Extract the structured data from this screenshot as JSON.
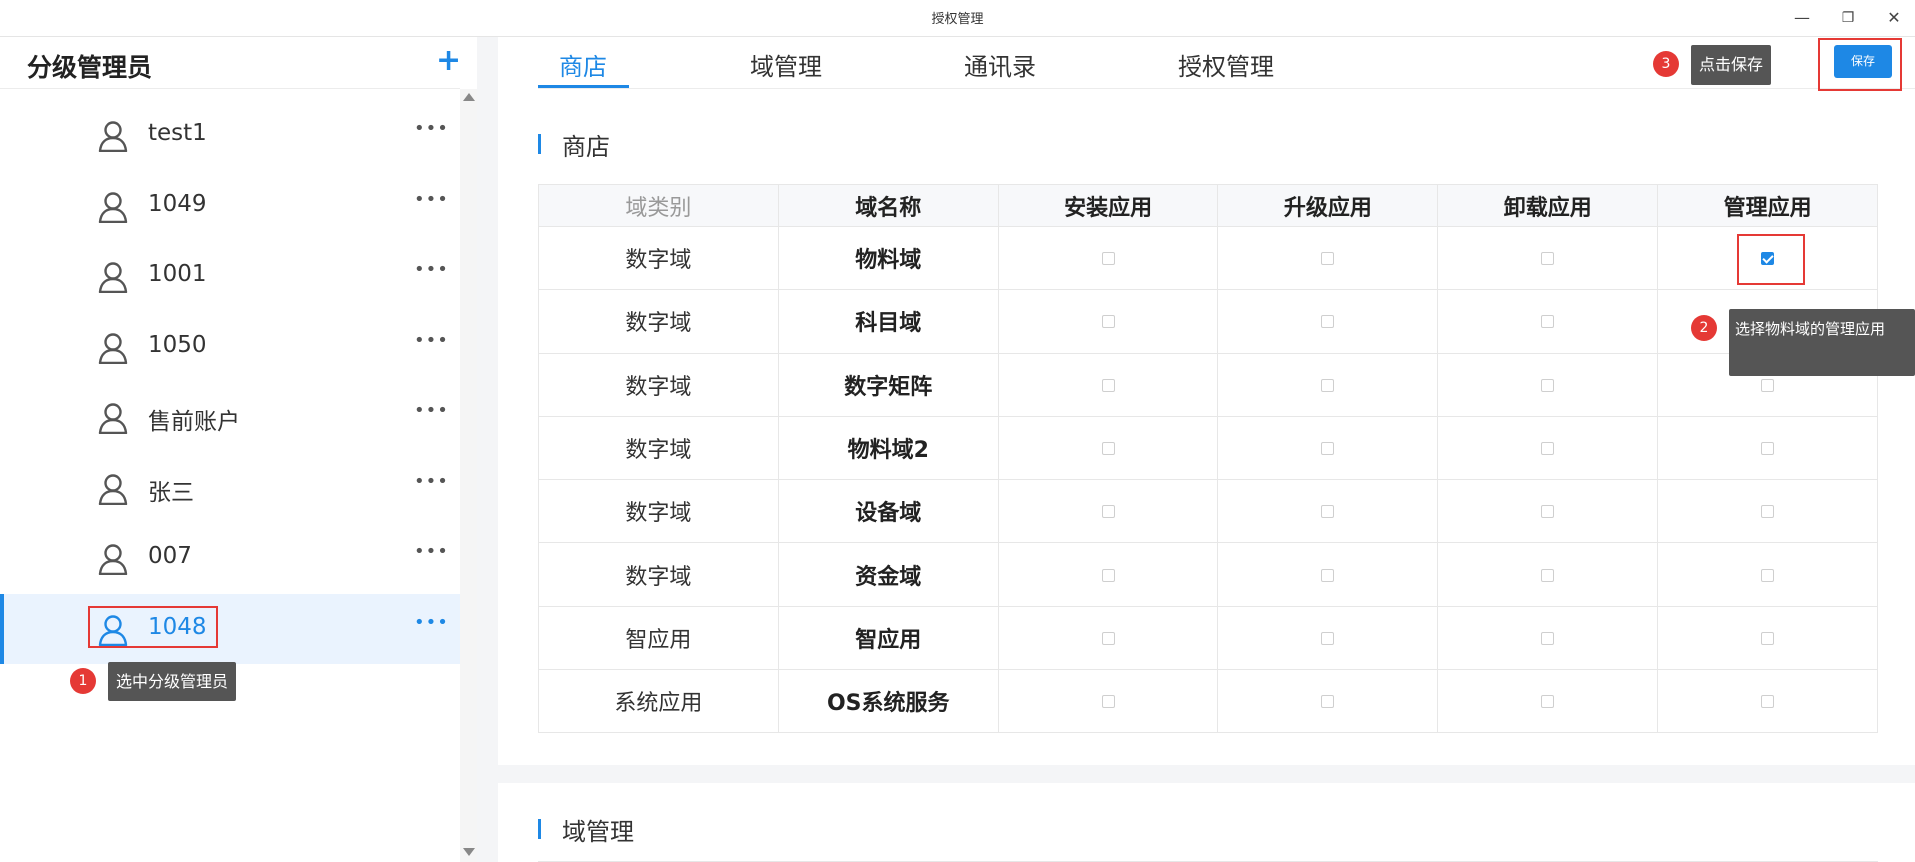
{
  "window": {
    "title": "授权管理",
    "min_icon": "minimize-icon",
    "max_icon": "restore-icon",
    "close_icon": "close-icon"
  },
  "sidebar": {
    "title": "分级管理员",
    "add_label": "+",
    "items": [
      {
        "label": "test1",
        "active": false
      },
      {
        "label": "1049",
        "active": false
      },
      {
        "label": "1001",
        "active": false
      },
      {
        "label": "1050",
        "active": false
      },
      {
        "label": "售前账户",
        "active": false
      },
      {
        "label": "张三",
        "active": false
      },
      {
        "label": "007",
        "active": false
      },
      {
        "label": "1048",
        "active": true
      }
    ],
    "more_label": "•••"
  },
  "tabs": [
    {
      "label": "商店",
      "active": true
    },
    {
      "label": "域管理",
      "active": false
    },
    {
      "label": "通讯录",
      "active": false
    },
    {
      "label": "授权管理",
      "active": false
    }
  ],
  "save_label": "保存",
  "sections": {
    "store": "商店",
    "domain": "域管理"
  },
  "table": {
    "headers": [
      "域类别",
      "域名称",
      "安装应用",
      "升级应用",
      "卸载应用",
      "管理应用"
    ],
    "rows": [
      {
        "category": "数字域",
        "name": "物料域",
        "install": false,
        "upgrade": false,
        "uninstall": false,
        "manage": true
      },
      {
        "category": "数字域",
        "name": "科目域",
        "install": false,
        "upgrade": false,
        "uninstall": false,
        "manage": false
      },
      {
        "category": "数字域",
        "name": "数字矩阵",
        "install": false,
        "upgrade": false,
        "uninstall": false,
        "manage": false
      },
      {
        "category": "数字域",
        "name": "物料域2",
        "install": false,
        "upgrade": false,
        "uninstall": false,
        "manage": false
      },
      {
        "category": "数字域",
        "name": "设备域",
        "install": false,
        "upgrade": false,
        "uninstall": false,
        "manage": false
      },
      {
        "category": "数字域",
        "name": "资金域",
        "install": false,
        "upgrade": false,
        "uninstall": false,
        "manage": false
      },
      {
        "category": "智应用",
        "name": "智应用",
        "install": false,
        "upgrade": false,
        "uninstall": false,
        "manage": false
      },
      {
        "category": "系统应用",
        "name": "OS系统服务",
        "install": false,
        "upgrade": false,
        "uninstall": false,
        "manage": false
      }
    ]
  },
  "annotations": {
    "step1": {
      "num": "1",
      "text": "选中分级管理员"
    },
    "step2": {
      "num": "2",
      "text": "选择物料域的管理应用"
    },
    "step3": {
      "num": "3",
      "text": "点击保存"
    }
  },
  "colors": {
    "accent": "#1e88e5",
    "annotation_red": "#e53935",
    "tooltip_bg": "#555555"
  }
}
